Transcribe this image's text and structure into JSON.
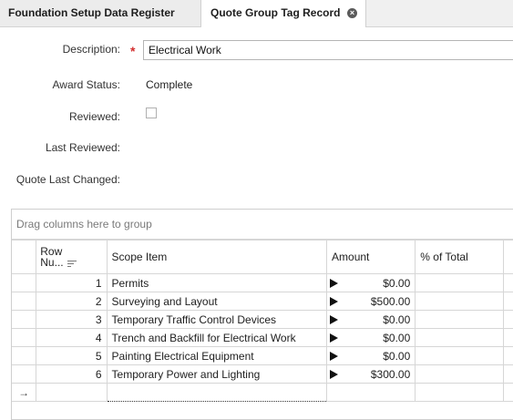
{
  "tabs": [
    {
      "label": "Foundation Setup Data Register"
    },
    {
      "label": "Quote Group Tag Record",
      "close_icon": "×"
    }
  ],
  "form": {
    "description_label": "Description:",
    "required_mark": "*",
    "description_value": "Electrical Work",
    "award_status_label": "Award Status:",
    "award_status_value": "Complete",
    "reviewed_label": "Reviewed:",
    "reviewed_checked": false,
    "last_reviewed_label": "Last Reviewed:",
    "quote_last_changed_label": "Quote Last Changed:"
  },
  "grid": {
    "group_panel_text": "Drag columns here to group",
    "columns": {
      "row_number": "Row Nu...",
      "row_number_line1": "Row",
      "row_number_line2": "Nu...",
      "scope_item": "Scope Item",
      "amount": "Amount",
      "percent_total": "% of Total"
    },
    "rows": [
      {
        "num": "1",
        "scope": "Permits",
        "amount": "$0.00",
        "percent": ""
      },
      {
        "num": "2",
        "scope": "Surveying and Layout",
        "amount": "$500.00",
        "percent": ""
      },
      {
        "num": "3",
        "scope": "Temporary Traffic Control Devices",
        "amount": "$0.00",
        "percent": ""
      },
      {
        "num": "4",
        "scope": "Trench and Backfill for Electrical Work",
        "amount": "$0.00",
        "percent": ""
      },
      {
        "num": "5",
        "scope": "Painting Electrical Equipment",
        "amount": "$0.00",
        "percent": ""
      },
      {
        "num": "6",
        "scope": "Temporary Power and Lighting",
        "amount": "$300.00",
        "percent": ""
      }
    ],
    "new_row_indicator": "→"
  },
  "colors": {
    "required": "#d32f2f",
    "tab_strip": "#f0f0f0",
    "grid_border": "#d6d6d6"
  },
  "icons": {
    "close": "close-circle-icon",
    "sort": "sort-lines-icon",
    "row_expand": "play-triangle-icon",
    "new_row": "arrow-right-icon"
  }
}
